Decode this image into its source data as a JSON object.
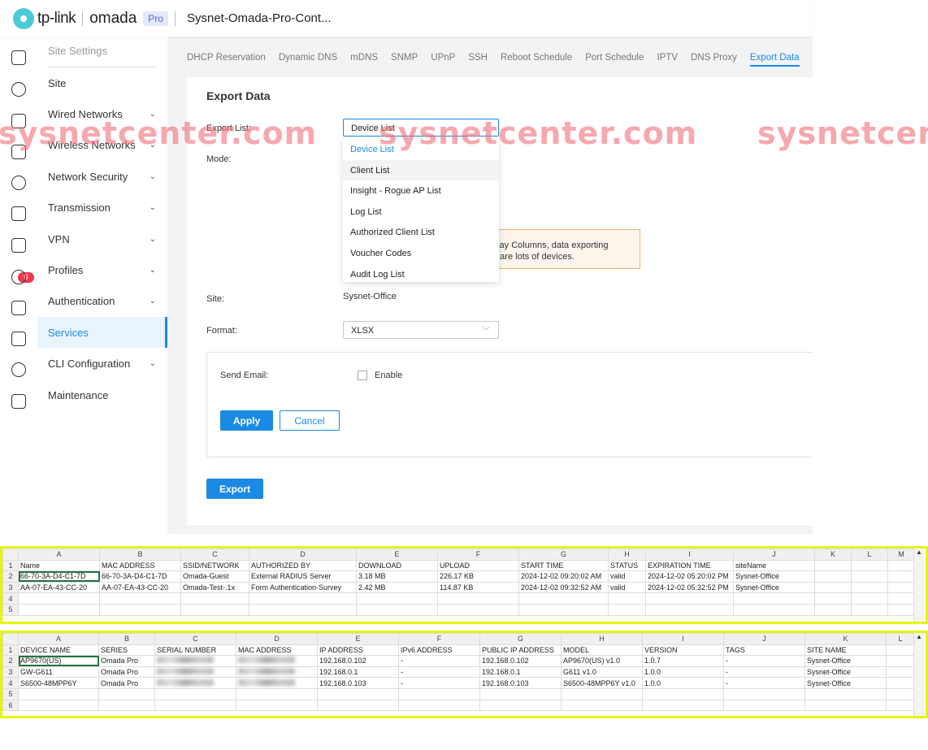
{
  "header": {
    "brand": "tp-link",
    "product": "omada",
    "edition": "Pro",
    "controller": "Sysnet-Omada-Pro-Cont..."
  },
  "watermark": "sysnetcenter.com",
  "rail": {
    "icons": [
      "dashboard-icon",
      "statistics-icon",
      "map-icon",
      "devices-icon",
      "clients-icon",
      "insight-icon",
      "logs-icon",
      "reports-icon",
      "tools-icon",
      "alerts-icon",
      "settings-icon",
      "analytics-icon"
    ],
    "badge": "9"
  },
  "sidebar": {
    "heading": "Site Settings",
    "items": [
      {
        "label": "Site",
        "expand": false
      },
      {
        "label": "Wired Networks",
        "expand": true
      },
      {
        "label": "Wireless Networks",
        "expand": true
      },
      {
        "label": "Network Security",
        "expand": true
      },
      {
        "label": "Transmission",
        "expand": true
      },
      {
        "label": "VPN",
        "expand": true
      },
      {
        "label": "Profiles",
        "expand": true
      },
      {
        "label": "Authentication",
        "expand": true
      },
      {
        "label": "Services",
        "expand": false,
        "active": true
      },
      {
        "label": "CLI Configuration",
        "expand": true
      },
      {
        "label": "Maintenance",
        "expand": false
      }
    ]
  },
  "tabs": [
    "DHCP Reservation",
    "Dynamic DNS",
    "mDNS",
    "SNMP",
    "UPnP",
    "SSH",
    "Reboot Schedule",
    "Port Schedule",
    "IPTV",
    "DNS Proxy",
    "Export Data"
  ],
  "active_tab": "Export Data",
  "form": {
    "title": "Export Data",
    "export_list_label": "Export List:",
    "export_list_value": "Device List",
    "options": [
      "Device List",
      "Client List",
      "Insight - Rogue AP List",
      "Log List",
      "Authorized Client List",
      "Voucher Codes",
      "Audit Log List"
    ],
    "mode_label": "Mode:",
    "warning_line1": "play Columns, data exporting",
    "warning_line2": "e are lots of devices.",
    "site_label": "Site:",
    "site_value": "Sysnet-Office",
    "format_label": "Format:",
    "format_value": "XLSX",
    "email_label": "Send Email:",
    "enable_label": "Enable",
    "enable_checked": false,
    "apply": "Apply",
    "cancel": "Cancel",
    "export": "Export"
  },
  "sheet1": {
    "cols": [
      "A",
      "B",
      "C",
      "D",
      "E",
      "F",
      "G",
      "H",
      "I",
      "J",
      "K",
      "L",
      "M"
    ],
    "rows": [
      [
        "Name",
        "MAC ADDRESS",
        "SSID/NETWORK",
        "AUTHORIZED BY",
        "DOWNLOAD",
        "UPLOAD",
        "START TIME",
        "STATUS",
        "EXPIRATION TIME",
        "siteName",
        "",
        "",
        ""
      ],
      [
        "66-70-3A-D4-C1-7D",
        "66-70-3A-D4-C1-7D",
        "Omada-Guest",
        "External RADIUS Server",
        "3.18 MB",
        "226.17 KB",
        "2024-12-02 09:20:02 AM",
        "valid",
        "2024-12-02 05:20:02 PM",
        "Sysnet-Office",
        "",
        "",
        ""
      ],
      [
        "AA-07-EA-43-CC-20",
        "AA-07-EA-43-CC-20",
        "Omada-Test-.1x",
        "Form Authentication-Survey",
        "2.42 MB",
        "114.87 KB",
        "2024-12-02 09:32:52 AM",
        "valid",
        "2024-12-02 05:32:52 PM",
        "Sysnet-Office",
        "",
        "",
        ""
      ],
      [
        "",
        "",
        "",
        "",
        "",
        "",
        "",
        "",
        "",
        "",
        "",
        "",
        ""
      ],
      [
        "",
        "",
        "",
        "",
        "",
        "",
        "",
        "",
        "",
        "",
        "",
        "",
        ""
      ]
    ]
  },
  "sheet2": {
    "cols": [
      "A",
      "B",
      "C",
      "D",
      "E",
      "F",
      "G",
      "H",
      "I",
      "J",
      "K",
      "L"
    ],
    "rows": [
      [
        "DEVICE NAME",
        "SERIES",
        "SERIAL NUMBER",
        "MAC ADDRESS",
        "IP ADDRESS",
        "IPv6 ADDRESS",
        "PUBLIC IP ADDRESS",
        "MODEL",
        "VERSION",
        "TAGS",
        "SITE NAME",
        ""
      ],
      [
        "AP9670(US)",
        "Omada Pro",
        "#blur",
        "#blur",
        "192.168.0.102",
        "-",
        "192.168.0.102",
        "AP9670(US) v1.0",
        "1.0.7",
        "-",
        "Sysnet-Office",
        ""
      ],
      [
        "GW-G611",
        "Omada Pro",
        "#blur",
        "#blur",
        "192.168.0.1",
        "-",
        "192.168.0.1",
        "G611 v1.0",
        "1.0.0",
        "-",
        "Sysnet-Office",
        ""
      ],
      [
        "S6500-48MPP6Y",
        "Omada Pro",
        "#blur",
        "#blur",
        "192.168.0.103",
        "-",
        "192.168.0.103",
        "S6500-48MPP6Y v1.0",
        "1.0.0",
        "-",
        "Sysnet-Office",
        ""
      ],
      [
        "",
        "",
        "",
        "",
        "",
        "",
        "",
        "",
        "",
        "",
        "",
        ""
      ],
      [
        "",
        "",
        "",
        "",
        "",
        "",
        "",
        "",
        "",
        "",
        "",
        ""
      ]
    ]
  },
  "colors": {
    "accent": "#1a8ae5",
    "highlight": "#e4f50f",
    "badge": "#f0364a"
  }
}
